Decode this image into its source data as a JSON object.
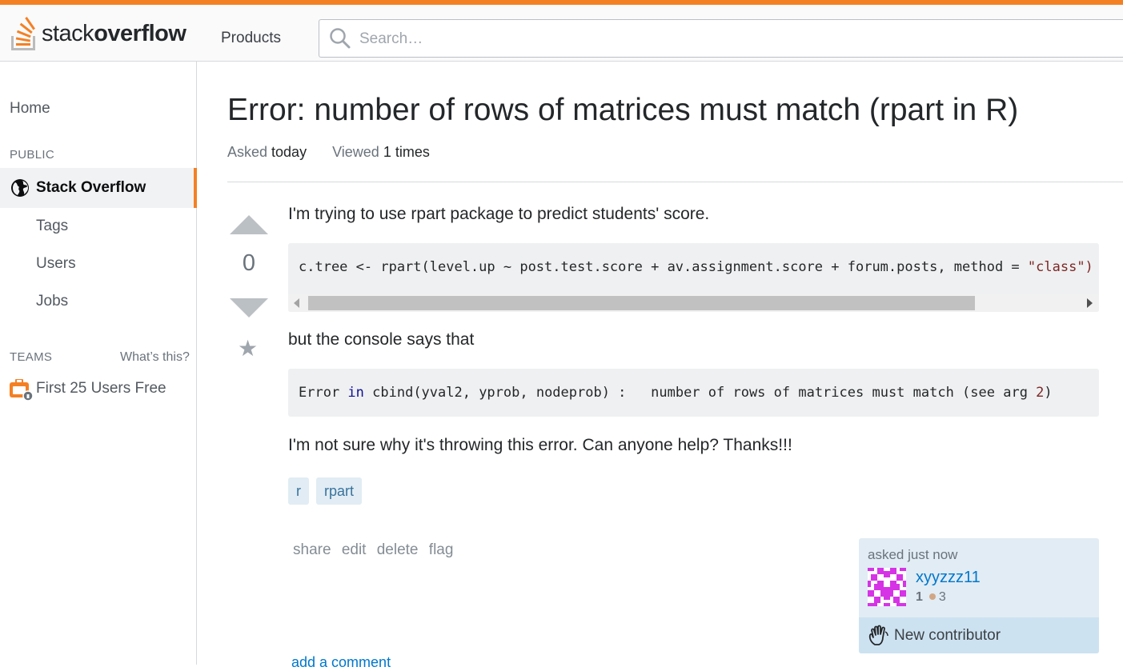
{
  "header": {
    "logo_light": "stack",
    "logo_bold": "overflow",
    "products_label": "Products",
    "search_placeholder": "Search…",
    "accent_color": "#f48024"
  },
  "sidebar": {
    "home": "Home",
    "public_heading": "PUBLIC",
    "stack_overflow": "Stack Overflow",
    "items": [
      "Tags",
      "Users",
      "Jobs"
    ],
    "teams_heading": "TEAMS",
    "whats_this": "What’s this?",
    "teams_free": "First 25 Users Free"
  },
  "question": {
    "title": "Error: number of rows of matrices must match (rpart in R)",
    "asked_label": "Asked",
    "asked_value": "today",
    "viewed_label": "Viewed",
    "viewed_value": "1 times",
    "vote_count": "0",
    "body_1": "I'm trying to use rpart package to predict students' score.",
    "code_1": {
      "plain": "c.tree <- rpart(level.up ~ post.test.score + av.assignment.score + forum.posts, method = ",
      "string": "\"class\")"
    },
    "body_2": "but the console says that",
    "code_2": {
      "p1": "Error ",
      "kw": "in",
      "p2": " cbind(yval2, yprob, nodeprob) :   number of rows of matrices must match (see arg ",
      "num": "2",
      "p3": ")"
    },
    "body_3": "I'm not sure why it's throwing this error. Can anyone help? Thanks!!!",
    "tags": [
      "r",
      "rpart"
    ],
    "menu": [
      "share",
      "edit",
      "delete",
      "flag"
    ],
    "add_comment": "add a comment"
  },
  "owner": {
    "asked_time": "asked just now",
    "username": "xyyzzz11",
    "reputation": "1",
    "bronze_badges": "3",
    "new_contributor": "New contributor"
  }
}
